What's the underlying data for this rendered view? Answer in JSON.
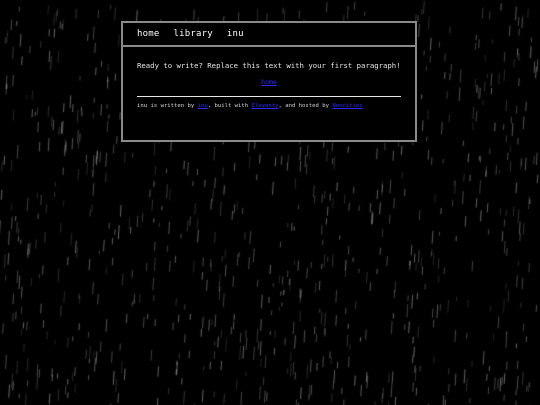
{
  "nav": {
    "items": [
      "home",
      "library",
      "inu"
    ]
  },
  "content": {
    "paragraph": "Ready to write? Replace this text with your first paragraph!",
    "link_label": "home"
  },
  "footer": {
    "prefix": "inu is written by ",
    "author_link": "inu",
    "middle": ", built with ",
    "tool_link": "Eleventy",
    "hosted": ", and hosted by ",
    "host_link": "Neocities"
  },
  "colors": {
    "background": "#000000",
    "border": "#8a8a8a",
    "text": "#e6e6e6",
    "link": "#2a2aff"
  }
}
